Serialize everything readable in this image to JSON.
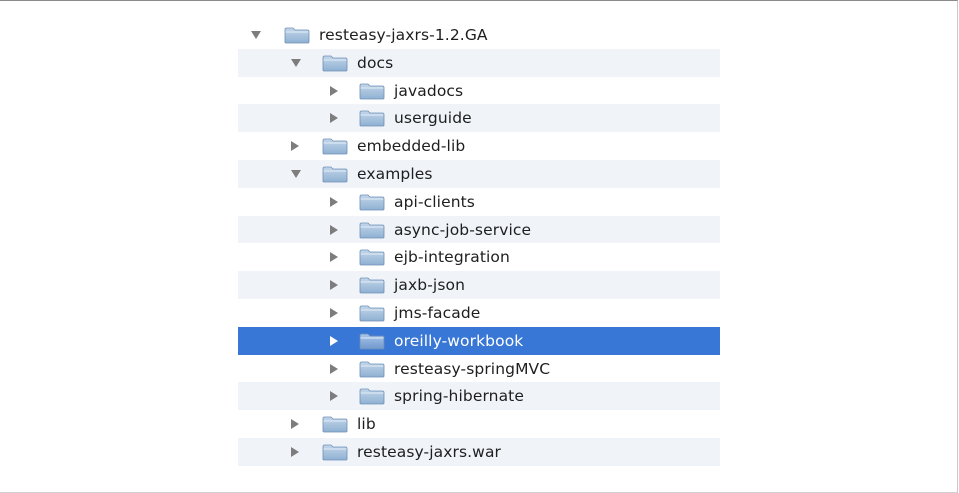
{
  "tree": {
    "items": [
      {
        "label": "resteasy-jaxrs-1.2.GA",
        "level": 0,
        "expanded": true,
        "selected": false,
        "icon": "folder-icon"
      },
      {
        "label": "docs",
        "level": 1,
        "expanded": true,
        "selected": false,
        "icon": "folder-icon"
      },
      {
        "label": "javadocs",
        "level": 2,
        "expanded": false,
        "selected": false,
        "icon": "folder-icon"
      },
      {
        "label": "userguide",
        "level": 2,
        "expanded": false,
        "selected": false,
        "icon": "folder-icon"
      },
      {
        "label": "embedded-lib",
        "level": 1,
        "expanded": false,
        "selected": false,
        "icon": "folder-icon"
      },
      {
        "label": "examples",
        "level": 1,
        "expanded": true,
        "selected": false,
        "icon": "folder-icon"
      },
      {
        "label": "api-clients",
        "level": 2,
        "expanded": false,
        "selected": false,
        "icon": "folder-icon"
      },
      {
        "label": "async-job-service",
        "level": 2,
        "expanded": false,
        "selected": false,
        "icon": "folder-icon"
      },
      {
        "label": "ejb-integration",
        "level": 2,
        "expanded": false,
        "selected": false,
        "icon": "folder-icon"
      },
      {
        "label": "jaxb-json",
        "level": 2,
        "expanded": false,
        "selected": false,
        "icon": "folder-icon"
      },
      {
        "label": "jms-facade",
        "level": 2,
        "expanded": false,
        "selected": false,
        "icon": "folder-icon"
      },
      {
        "label": "oreilly-workbook",
        "level": 2,
        "expanded": false,
        "selected": true,
        "icon": "folder-icon"
      },
      {
        "label": "resteasy-springMVC",
        "level": 2,
        "expanded": false,
        "selected": false,
        "icon": "folder-icon"
      },
      {
        "label": "spring-hibernate",
        "level": 2,
        "expanded": false,
        "selected": false,
        "icon": "folder-icon"
      },
      {
        "label": "lib",
        "level": 1,
        "expanded": false,
        "selected": false,
        "icon": "folder-icon"
      },
      {
        "label": "resteasy-jaxrs.war",
        "level": 1,
        "expanded": false,
        "selected": false,
        "icon": "folder-icon"
      }
    ]
  },
  "colors": {
    "selection": "#3877d6",
    "alt_row": "#f0f4f9",
    "disclosure_triangle": "#7d7d7d",
    "folder_body": "#9fb9d6"
  }
}
